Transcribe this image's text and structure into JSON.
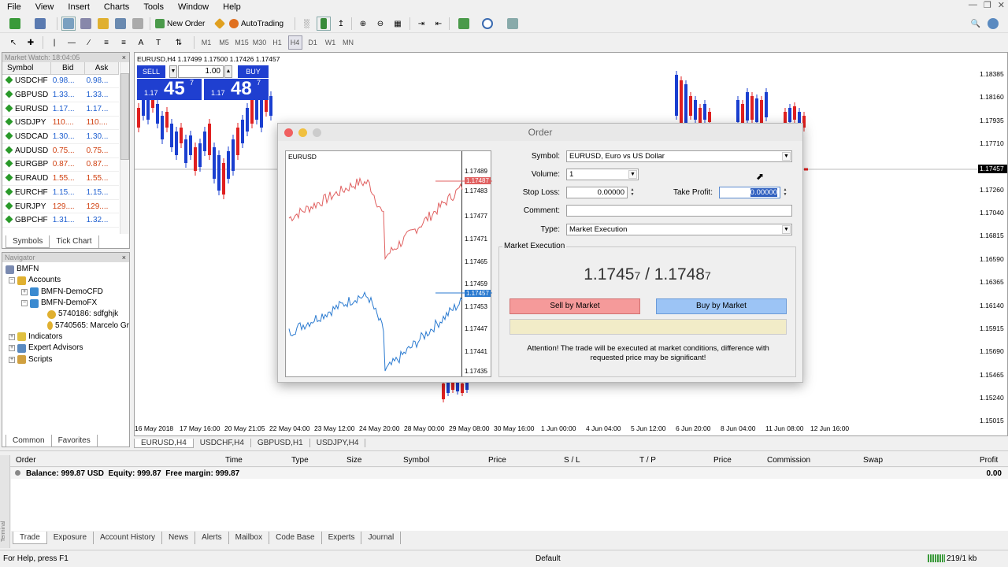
{
  "menu": [
    "File",
    "View",
    "Insert",
    "Charts",
    "Tools",
    "Window",
    "Help"
  ],
  "toolbar": {
    "new_order": "New Order",
    "autotrading": "AutoTrading"
  },
  "timeframes": [
    "M1",
    "M5",
    "M15",
    "M30",
    "H1",
    "H4",
    "D1",
    "W1",
    "MN"
  ],
  "market_watch": {
    "title": "Market Watch: 18:04:05",
    "cols": [
      "Symbol",
      "Bid",
      "Ask"
    ],
    "rows": [
      {
        "s": "USDCHF",
        "b": "0.98...",
        "a": "0.98...",
        "d": "up"
      },
      {
        "s": "GBPUSD",
        "b": "1.33...",
        "a": "1.33...",
        "d": "up"
      },
      {
        "s": "EURUSD",
        "b": "1.17...",
        "a": "1.17...",
        "d": "up"
      },
      {
        "s": "USDJPY",
        "b": "110....",
        "a": "110....",
        "d": "dn"
      },
      {
        "s": "USDCAD",
        "b": "1.30...",
        "a": "1.30...",
        "d": "up"
      },
      {
        "s": "AUDUSD",
        "b": "0.75...",
        "a": "0.75...",
        "d": "dn"
      },
      {
        "s": "EURGBP",
        "b": "0.87...",
        "a": "0.87...",
        "d": "dn"
      },
      {
        "s": "EURAUD",
        "b": "1.55...",
        "a": "1.55...",
        "d": "dn"
      },
      {
        "s": "EURCHF",
        "b": "1.15...",
        "a": "1.15...",
        "d": "up"
      },
      {
        "s": "EURJPY",
        "b": "129....",
        "a": "129....",
        "d": "dn"
      },
      {
        "s": "GBPCHF",
        "b": "1.31...",
        "a": "1.32...",
        "d": "up"
      }
    ],
    "tabs": [
      "Symbols",
      "Tick Chart"
    ]
  },
  "navigator": {
    "title": "Navigator",
    "root": "BMFN",
    "accounts": "Accounts",
    "acc1": "BMFN-DemoCFD",
    "acc2": "BMFN-DemoFX",
    "sub1": "5740186: sdfghjk",
    "sub2": "5740565: Marcelo Gr",
    "indicators": "Indicators",
    "experts": "Expert Advisors",
    "scripts": "Scripts",
    "tabs": [
      "Common",
      "Favorites"
    ]
  },
  "chart": {
    "header": "EURUSD,H4  1.17499 1.17500 1.17426 1.17457",
    "sell": "SELL",
    "buy": "BUY",
    "lot": "1.00",
    "sell_price": {
      "pre": "1.17",
      "big": "45",
      "sup": "7"
    },
    "buy_price": {
      "pre": "1.17",
      "big": "48",
      "sup": "7"
    },
    "yticks": [
      "1.18385",
      "1.18160",
      "1.17935",
      "1.17710",
      "1.17457",
      "1.17260",
      "1.17040",
      "1.16815",
      "1.16590",
      "1.16365",
      "1.16140",
      "1.15915",
      "1.15690",
      "1.15465",
      "1.15240",
      "1.15015"
    ],
    "xticks": [
      "16 May 2018",
      "17 May 16:00",
      "20 May 21:05",
      "22 May 04:00",
      "23 May 12:00",
      "24 May 20:00",
      "28 May 00:00",
      "29 May 08:00",
      "30 May 16:00",
      "1 Jun 00:00",
      "4 Jun 04:00",
      "5 Jun 12:00",
      "6 Jun 20:00",
      "8 Jun 04:00",
      "11 Jun 08:00",
      "12 Jun 16:00"
    ],
    "tabs": [
      "EURUSD,H4",
      "USDCHF,H4",
      "GBPUSD,H1",
      "USDJPY,H4"
    ]
  },
  "order": {
    "title": "Order",
    "mini_symbol": "EURUSD",
    "mini_ticks": [
      "1.17489",
      "1.17487",
      "1.17483",
      "1.17477",
      "1.17471",
      "1.17465",
      "1.17459",
      "1.17457",
      "1.17453",
      "1.17447",
      "1.17441",
      "1.17435"
    ],
    "symbol_label": "Symbol:",
    "symbol": "EURUSD, Euro vs US Dollar",
    "volume_label": "Volume:",
    "volume": "1",
    "sl_label": "Stop Loss:",
    "sl": "0.00000",
    "tp_label": "Take Profit:",
    "tp": "0.00000",
    "comment_label": "Comment:",
    "comment": "",
    "type_label": "Type:",
    "type": "Market Execution",
    "group": "Market Execution",
    "bid": "1.1745",
    "bid_small": "7",
    "sep": " / ",
    "ask": "1.1748",
    "ask_small": "7",
    "sell_btn": "Sell by Market",
    "buy_btn": "Buy by Market",
    "warning": "Attention! The trade will be executed at market conditions, difference with requested price may be significant!"
  },
  "terminal": {
    "cols": [
      "Order",
      "Time",
      "Type",
      "Size",
      "Symbol",
      "Price",
      "S / L",
      "T / P",
      "Price",
      "Commission",
      "Swap",
      "Profit"
    ],
    "balance": "Balance: 999.87 USD  Equity: 999.87  Free margin: 999.87",
    "profit": "0.00",
    "tabs": [
      "Trade",
      "Exposure",
      "Account History",
      "News",
      "Alerts",
      "Mailbox",
      "Code Base",
      "Experts",
      "Journal"
    ],
    "side": "Terminal"
  },
  "status": {
    "help": "For Help, press F1",
    "profile": "Default",
    "traffic": "219/1 kb"
  },
  "colors": {
    "sell_btn": "#f59a9a",
    "buy_btn": "#9cc4f5",
    "buy_panel": "#1f3fd0",
    "ask_line": "#e06060",
    "bid_line": "#2a7ad0"
  }
}
